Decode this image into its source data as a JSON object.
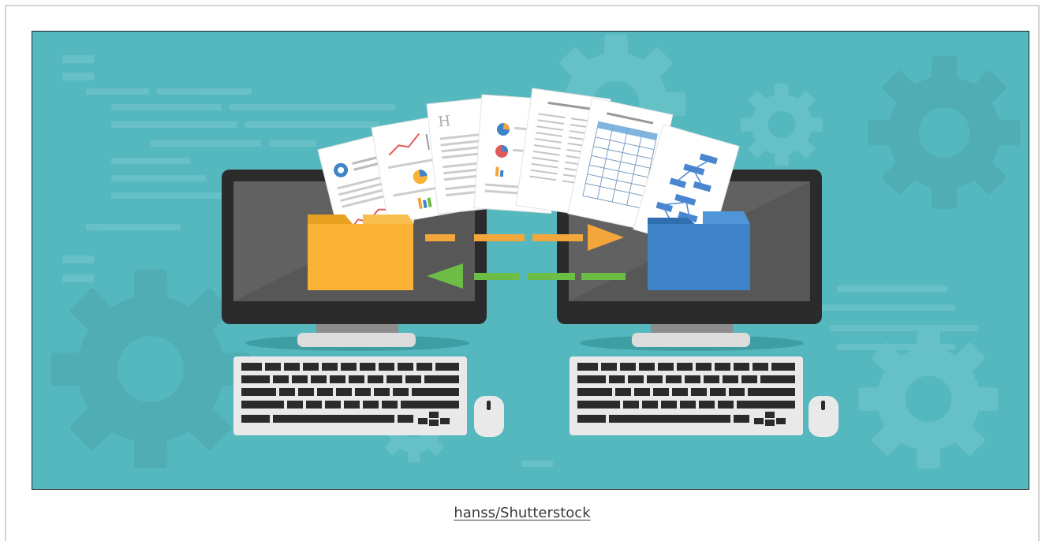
{
  "figure": {
    "credit_text": "hanss/Shutterstock",
    "alt": "File transfer between two computers illustration"
  },
  "colors": {
    "background_teal": "#55b8be",
    "folder_yellow": "#f9b233",
    "folder_blue": "#3f83c8",
    "arrow_orange": "#f3a63b",
    "arrow_green": "#6cbd45",
    "monitor_black": "#2b2b2b",
    "screen_gray": "#575757"
  },
  "icons": {
    "left_folder": "folder-icon",
    "right_folder": "folder-icon",
    "send_arrow": "arrow-right-icon",
    "receive_arrow": "arrow-left-icon",
    "gear": "gear-icon"
  }
}
